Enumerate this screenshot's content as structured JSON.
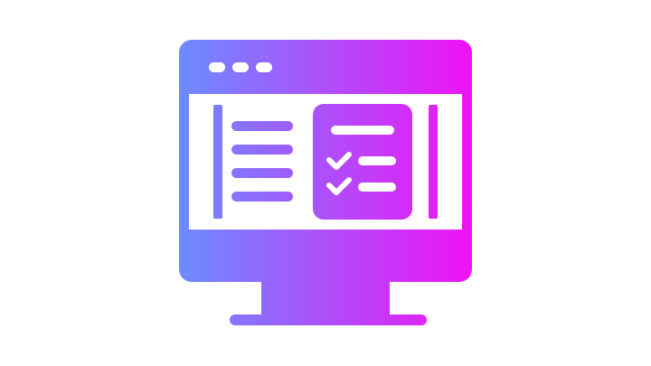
{
  "icon": {
    "name": "monitor-checklist-icon",
    "gradient": {
      "start": "#6C8CFF",
      "end": "#F012F5"
    },
    "screen_color": "#FFFFFF",
    "background": "#FFFFFF",
    "window_dots": 3,
    "list_lines": 4,
    "checklist_items": [
      {
        "checked": false
      },
      {
        "checked": true
      },
      {
        "checked": true
      }
    ]
  }
}
